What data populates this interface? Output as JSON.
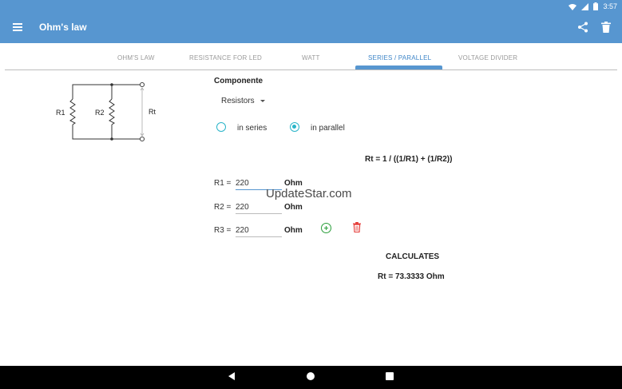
{
  "status": {
    "time": "3:57"
  },
  "appbar": {
    "title": "Ohm's law"
  },
  "tabs": [
    {
      "label": "OHM'S LAW"
    },
    {
      "label": "RESISTANCE FOR LED"
    },
    {
      "label": "WATT"
    },
    {
      "label": "SERIES / PARALLEL",
      "active": true
    },
    {
      "label": "VOLTAGE DIVIDER"
    }
  ],
  "circuit": {
    "r1": "R1",
    "r2": "R2",
    "rt": "Rt"
  },
  "form": {
    "componente_label": "Componente",
    "component_selected": "Resistors",
    "radio_series": "in series",
    "radio_parallel": "in parallel",
    "selected_mode": "parallel",
    "formula": "Rt = 1 / ((1/R1) + (1/R2))",
    "resistors": [
      {
        "label": "R1 =",
        "value": "220",
        "unit": "Ohm"
      },
      {
        "label": "R2 =",
        "value": "220",
        "unit": "Ohm"
      },
      {
        "label": "R3 =",
        "value": "220",
        "unit": "Ohm"
      }
    ],
    "calculate_label": "CALCULATES",
    "result": "Rt = 73.3333 Ohm"
  },
  "watermark": "UpdateStar.com",
  "colors": {
    "primary": "#5796d0",
    "accent": "#2bb5c9",
    "add": "#2a9e3a",
    "remove": "#e53935"
  }
}
